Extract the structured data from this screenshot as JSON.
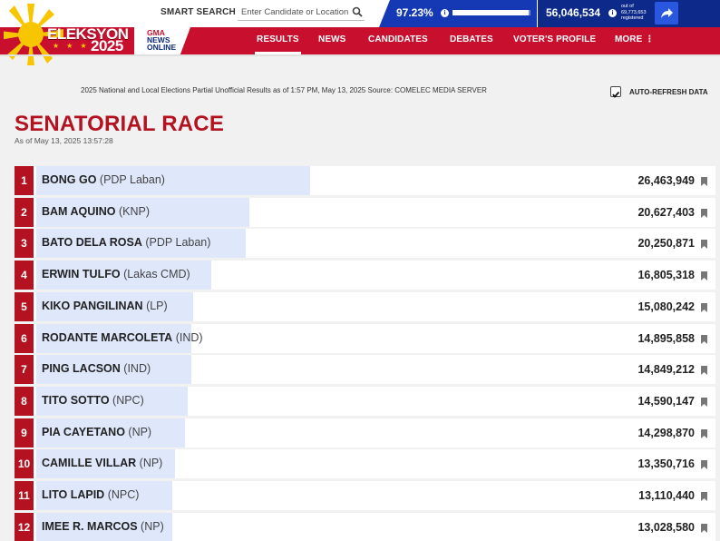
{
  "header": {
    "logo_word": "ELEKSYON",
    "logo_year": "2025",
    "partner_logo": [
      "GMA",
      "NEWS",
      "ONLINE"
    ],
    "search_label": "SMART SEARCH",
    "search_placeholder": "Enter Candidate or Location",
    "progress_pct_text": "97.23%",
    "progress_fraction": 0.9723,
    "votes_counted": "56,046,534",
    "registered_text": "out of 69,773,653 registered",
    "nav": [
      "RESULTS",
      "NEWS",
      "CANDIDATES",
      "DEBATES",
      "VOTER'S PROFILE",
      "MORE ⋮"
    ]
  },
  "info": {
    "source_note": "2025 National and Local Elections Partial Unofficial Results as of 1:57 PM, May 13, 2025 Source: COMELEC MEDIA SERVER",
    "auto_refresh_label": "AUTO-REFRESH DATA",
    "auto_refresh_checked": true
  },
  "race": {
    "title": "SENATORIAL RACE",
    "as_of": "As of May 13, 2025 13:57:28"
  },
  "colors": {
    "brand_red": "#c8102e",
    "rank_red": "#b41220",
    "progress_blue": "#1539b5",
    "votes_blue": "#0d2a8a",
    "bar_blue": "#dfe7fb"
  },
  "candidates": [
    {
      "rank": "1",
      "name": "BONG GO",
      "party": "(PDP Laban)",
      "votes": "26,463,949",
      "share": 0.36
    },
    {
      "rank": "2",
      "name": "BAM AQUINO",
      "party": "(KNP)",
      "votes": "20,627,403",
      "share": 0.28
    },
    {
      "rank": "3",
      "name": "BATO DELA ROSA",
      "party": "(PDP Laban)",
      "votes": "20,250,871",
      "share": 0.275
    },
    {
      "rank": "4",
      "name": "ERWIN TULFO",
      "party": "(Lakas CMD)",
      "votes": "16,805,318",
      "share": 0.23
    },
    {
      "rank": "5",
      "name": "KIKO PANGILINAN",
      "party": "(LP)",
      "votes": "15,080,242",
      "share": 0.206
    },
    {
      "rank": "6",
      "name": "RODANTE MARCOLETA",
      "party": "(IND)",
      "votes": "14,895,858",
      "share": 0.204
    },
    {
      "rank": "7",
      "name": "PING LACSON",
      "party": "(IND)",
      "votes": "14,849,212",
      "share": 0.203
    },
    {
      "rank": "8",
      "name": "TITO SOTTO",
      "party": "(NPC)",
      "votes": "14,590,147",
      "share": 0.199
    },
    {
      "rank": "9",
      "name": "PIA CAYETANO",
      "party": "(NP)",
      "votes": "14,298,870",
      "share": 0.195
    },
    {
      "rank": "10",
      "name": "CAMILLE VILLAR",
      "party": "(NP)",
      "votes": "13,350,716",
      "share": 0.182
    },
    {
      "rank": "11",
      "name": "LITO LAPID",
      "party": "(NPC)",
      "votes": "13,110,440",
      "share": 0.179
    },
    {
      "rank": "12",
      "name": "IMEE R. MARCOS",
      "party": "(NP)",
      "votes": "13,028,580",
      "share": 0.178
    }
  ]
}
